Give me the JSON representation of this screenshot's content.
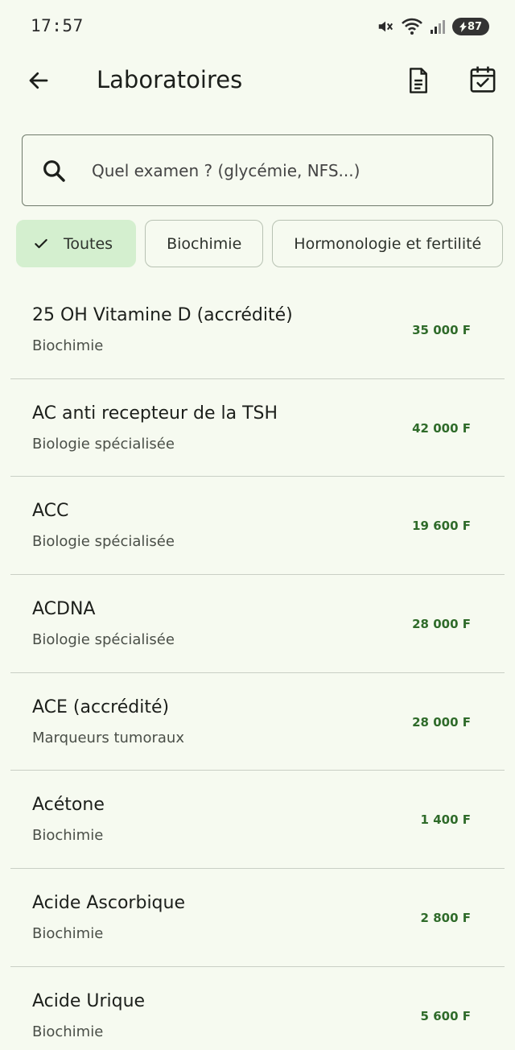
{
  "status_bar": {
    "time": "17:57",
    "battery": "87",
    "icons": [
      "mute-icon",
      "wifi-icon",
      "signal-icon",
      "battery-icon"
    ]
  },
  "header": {
    "title": "Laboratoires",
    "icons": [
      "back-arrow-icon",
      "document-icon",
      "calendar-check-icon"
    ]
  },
  "search": {
    "placeholder": "Quel examen ? (glycémie, NFS...)",
    "value": ""
  },
  "filters": [
    {
      "label": "Toutes",
      "selected": true
    },
    {
      "label": "Biochimie",
      "selected": false
    },
    {
      "label": "Hormonologie et fertilité",
      "selected": false
    }
  ],
  "exams": [
    {
      "name": "25 OH Vitamine D (accrédité)",
      "category": "Biochimie",
      "price": "35 000 F"
    },
    {
      "name": "AC anti recepteur de la TSH",
      "category": "Biologie spécialisée",
      "price": "42 000 F"
    },
    {
      "name": "ACC",
      "category": "Biologie spécialisée",
      "price": "19 600 F"
    },
    {
      "name": "ACDNA",
      "category": "Biologie spécialisée",
      "price": "28 000 F"
    },
    {
      "name": "ACE (accrédité)",
      "category": "Marqueurs tumoraux",
      "price": "28 000 F"
    },
    {
      "name": "Acétone",
      "category": "Biochimie",
      "price": "1 400 F"
    },
    {
      "name": "Acide Ascorbique",
      "category": "Biochimie",
      "price": "2 800 F"
    },
    {
      "name": "Acide Urique",
      "category": "Biochimie",
      "price": "5 600 F"
    }
  ],
  "colors": {
    "background": "#f6faf0",
    "selected_chip": "#d4efcf",
    "price": "#2f6b2a"
  }
}
